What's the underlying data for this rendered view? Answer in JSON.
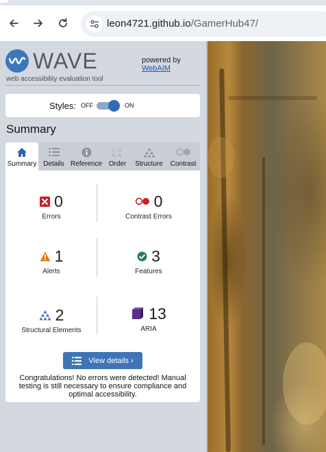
{
  "browser": {
    "url_host": "leon4721.github.io",
    "url_path": "/GamerHub47/"
  },
  "wave": {
    "logo_text": "WAVE",
    "tagline": "web accessibility evaluation tool",
    "powered_by": "powered by",
    "powered_link": "WebAIM",
    "styles_label": "Styles:",
    "toggle_off": "OFF",
    "toggle_on": "ON",
    "styles_on": true,
    "section_title": "Summary",
    "tabs": [
      {
        "label": "Summary",
        "icon": "home-icon",
        "active": true
      },
      {
        "label": "Details",
        "icon": "list-icon",
        "active": false
      },
      {
        "label": "Reference",
        "icon": "info-icon",
        "active": false
      },
      {
        "label": "Order",
        "icon": "order-icon",
        "active": false
      },
      {
        "label": "Structure",
        "icon": "structure-icon",
        "active": false
      },
      {
        "label": "Contrast",
        "icon": "contrast-icon",
        "active": false
      }
    ],
    "stats": {
      "errors": {
        "count": "0",
        "label": "Errors",
        "icon": "error-x-icon",
        "color": "#c8202b"
      },
      "contrast_errors": {
        "count": "0",
        "label": "Contrast Errors",
        "icon": "contrast-error-icon",
        "color": "#c8202b"
      },
      "alerts": {
        "count": "1",
        "label": "Alerts",
        "icon": "alert-triangle-icon",
        "color": "#e07a10"
      },
      "features": {
        "count": "3",
        "label": "Features",
        "icon": "check-circle-icon",
        "color": "#2e7d4f"
      },
      "structural": {
        "count": "2",
        "label": "Structural Elements",
        "icon": "structure-icon",
        "color": "#3a6fb8"
      },
      "aria": {
        "count": "13",
        "label": "ARIA",
        "icon": "aria-cube-icon",
        "color": "#5b2f8a"
      }
    },
    "view_details": "View details ›",
    "congrats": "Congratulations! No errors were detected! Manual testing is still necessary to ensure compliance and optimal accessibility."
  }
}
